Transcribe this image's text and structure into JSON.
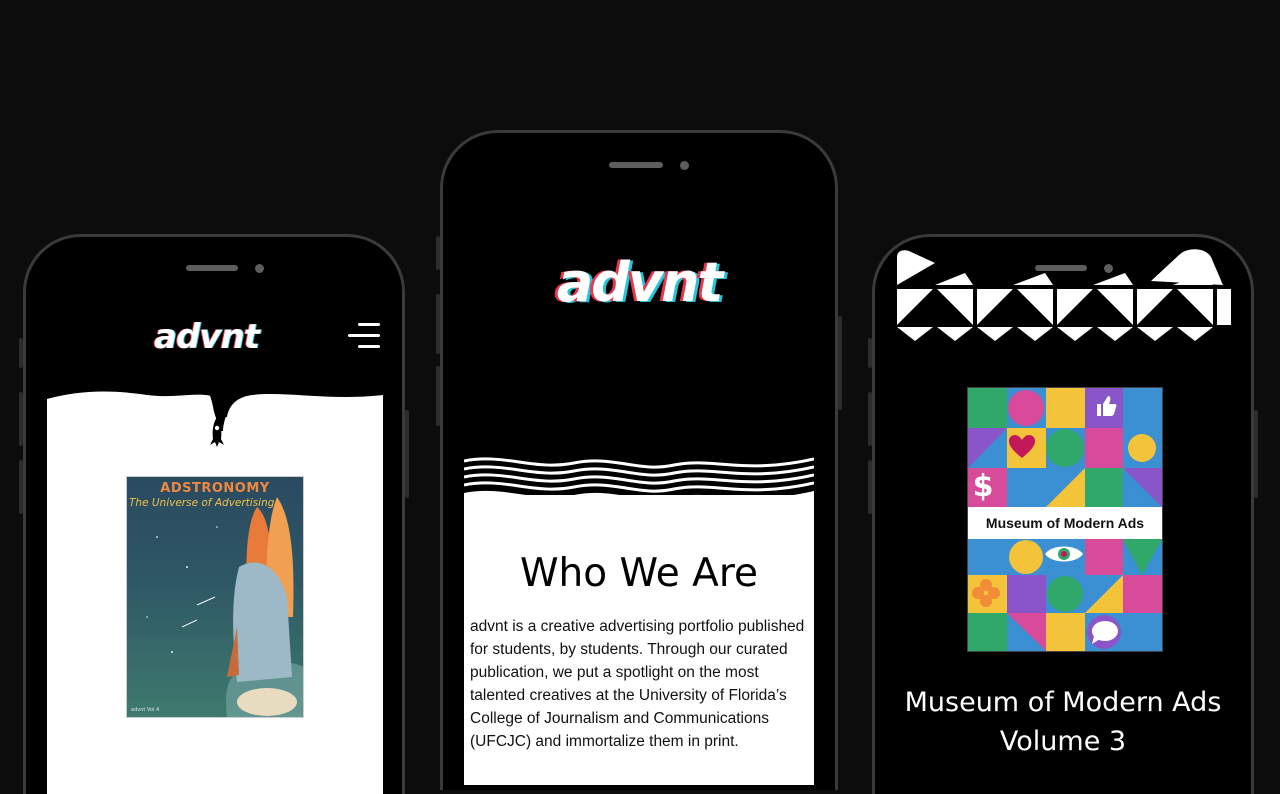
{
  "left_phone": {
    "logo": "advnt",
    "cover": {
      "title": "ADSTRONOMY",
      "subtitle": "The Universe of Advertising",
      "fine_print": "advnt Vol 4"
    }
  },
  "middle_phone": {
    "logo": "advnt",
    "heading": "Who We Are",
    "body": "advnt is a creative advertising portfolio published for students, by students. Through our curated publication, we put a spotlight on the most talented creatives at the University of Florida’s College of Journalism and Communications (UFCJC) and immortalize them in print."
  },
  "right_phone": {
    "cover_label": "Museum of Modern Ads",
    "title": "Museum of Modern Ads",
    "subtitle": "Volume 3"
  },
  "colors": {
    "background": "#0c0c0c",
    "phone_frame": "#3a3a3a",
    "logo_red": "#e8344c",
    "logo_cyan": "#27c4d9"
  },
  "icons": [
    "menu-icon",
    "rocket-icon",
    "thumbs-up-icon",
    "heart-icon",
    "dollar-icon",
    "eye-icon",
    "speech-bubble-icon"
  ]
}
